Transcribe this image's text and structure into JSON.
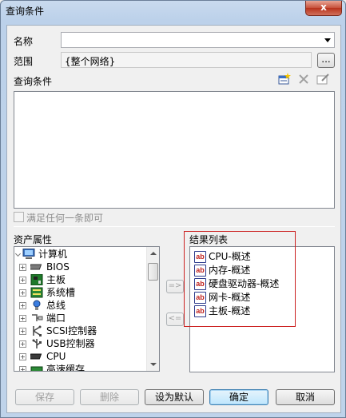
{
  "window": {
    "title": "查询条件",
    "close_glyph": "x"
  },
  "form": {
    "name_label": "名称",
    "name_value": "",
    "scope_label": "范围",
    "scope_value": "{整个网络}",
    "scope_browse_label": "..."
  },
  "conditions": {
    "label": "查询条件",
    "match_any_label": "满足任何一条即可",
    "match_any_checked": false
  },
  "assets": {
    "label": "资产属性",
    "root": "计算机",
    "items": [
      {
        "label": "BIOS",
        "icon": "chip-icon"
      },
      {
        "label": "主板",
        "icon": "motherboard-icon"
      },
      {
        "label": "系统槽",
        "icon": "slot-icon"
      },
      {
        "label": "总线",
        "icon": "bus-icon"
      },
      {
        "label": "端口",
        "icon": "port-icon"
      },
      {
        "label": "SCSI控制器",
        "icon": "scsi-icon"
      },
      {
        "label": "USB控制器",
        "icon": "usb-icon"
      },
      {
        "label": "CPU",
        "icon": "cpu-icon"
      },
      {
        "label": "高速缓存",
        "icon": "cache-icon"
      }
    ]
  },
  "results": {
    "label": "结果列表",
    "badge": "ab",
    "items": [
      "CPU-概述",
      "内存-概述",
      "硬盘驱动器-概述",
      "网卡-概述",
      "主板-概述"
    ]
  },
  "transfer": {
    "add_label": "=>",
    "remove_label": "<="
  },
  "buttons": {
    "save": "保存",
    "delete": "删除",
    "set_default": "设为默认",
    "ok": "确定",
    "cancel": "取消"
  },
  "colors": {
    "highlight_box": "#cc2222",
    "close_button": "#c7503a"
  }
}
